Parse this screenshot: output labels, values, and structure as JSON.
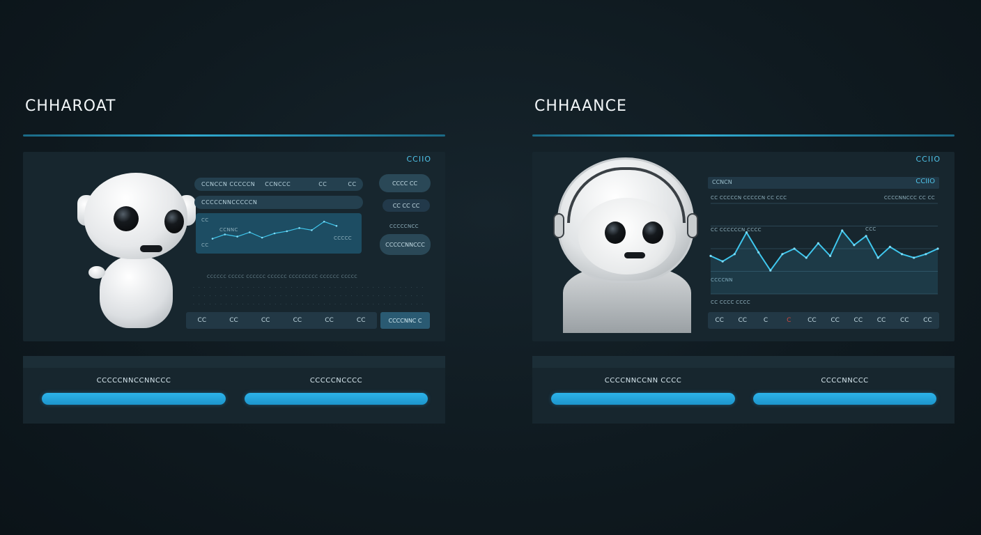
{
  "left_panel": {
    "title": "CHHAROAT",
    "badge": "CCIIO",
    "pills": [
      {
        "items": [
          "CCNCCN CCCCCN",
          "CCNCCC",
          "CC",
          "CC"
        ]
      },
      {
        "items": [
          "CCCCCNNCCCCCN"
        ]
      },
      {
        "items": [
          "CCCC"
        ]
      }
    ],
    "side_pills": [
      "CCCC CC",
      "CC CC CC",
      "CCCCCNNCCC"
    ],
    "side_label": "CCCCCNCC",
    "chart_labels": [
      "CC",
      "CC",
      "CCNNC",
      "CCCCC"
    ],
    "table_header": "CCCCCC  CCCCC  CCCCCC CCCCCC CCCCCCCCC CCCCCC  CCCCC",
    "toolbar": [
      "CC",
      "CC",
      "CC",
      "CC",
      "CC",
      "CC"
    ],
    "toolbar_cta": "CCCCNNC C",
    "buttons": [
      {
        "label": "CCCCCNNCCNNCCC"
      },
      {
        "label": "CCCCCNCCCC"
      }
    ]
  },
  "right_panel": {
    "title": "CHHAANCE",
    "badge": "CCIIO",
    "chart_header": {
      "left": "CCNCN",
      "right": "CCIIO"
    },
    "row_labels": [
      "CC CCCCCN CCCCCN CC CCC",
      "CCCCNNCCC  CC CC",
      "CC CCCCCCN CCCC",
      "CCC",
      "CCCCNN",
      "CC CCCC  CCCC"
    ],
    "toolbar": [
      "CC",
      "CC",
      "C",
      "C",
      "CC",
      "CC",
      "CC",
      "CC",
      "CC",
      "CC"
    ],
    "buttons": [
      {
        "label": "CCCCNNCCNN CCCC"
      },
      {
        "label": "CCCCNNCCC"
      }
    ]
  },
  "chart_data": [
    {
      "type": "line",
      "title": "",
      "x": [
        0,
        1,
        2,
        3,
        4,
        5,
        6,
        7,
        8,
        9,
        10
      ],
      "series": [
        {
          "values": [
            20,
            28,
            24,
            32,
            22,
            30,
            34,
            40,
            36,
            52,
            44
          ]
        }
      ],
      "ylim": [
        0,
        60
      ]
    },
    {
      "type": "line",
      "title": "",
      "x": [
        0,
        1,
        2,
        3,
        4,
        5,
        6,
        7,
        8,
        9,
        10,
        11,
        12,
        13,
        14,
        15,
        16,
        17,
        18,
        19
      ],
      "series": [
        {
          "values": [
            42,
            36,
            44,
            68,
            46,
            26,
            44,
            50,
            40,
            56,
            42,
            70,
            54,
            64,
            40,
            52,
            44,
            40,
            44,
            50
          ]
        }
      ],
      "ylim": [
        0,
        100
      ]
    }
  ],
  "colors": {
    "accent": "#2cb3ea",
    "card": "#17262e",
    "line": "#3fc7ee"
  }
}
